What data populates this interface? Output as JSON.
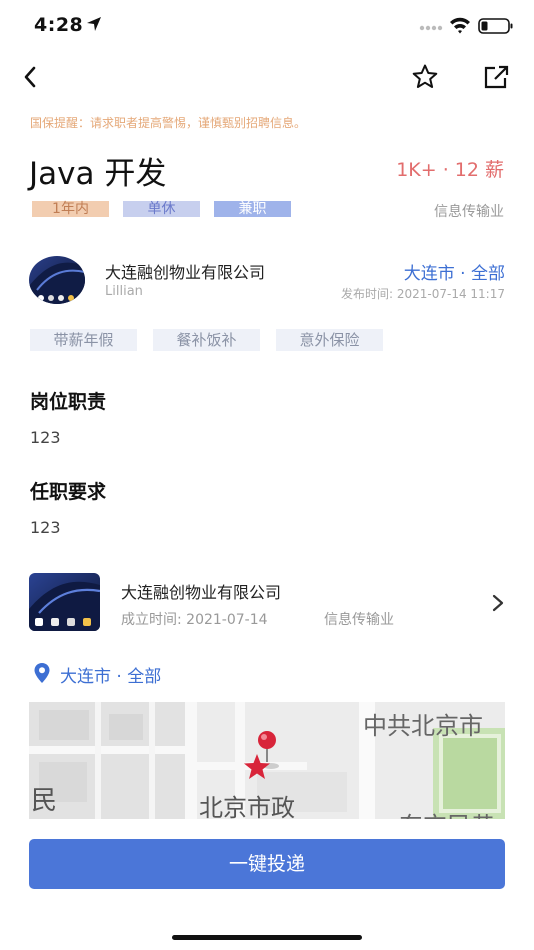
{
  "status_bar": {
    "time": "4:28"
  },
  "notice": "国保提醒：请求职者提高警惕，谨慎甄别招聘信息。",
  "job": {
    "title": "Java 开发",
    "salary": "1K+ · 12 薪",
    "tags": [
      "1年内",
      "单休",
      "兼职"
    ],
    "industry": "信息传输业"
  },
  "company_header": {
    "name": "大连融创物业有限公司",
    "recruiter": "Lillian",
    "location": "大连市 · 全部",
    "publish_time": "发布时间: 2021-07-14 11:17"
  },
  "benefits": [
    "带薪年假",
    "餐补饭补",
    "意外保险"
  ],
  "duties": {
    "title": "岗位职责",
    "text": "123"
  },
  "requirements": {
    "title": "任职要求",
    "text": "123"
  },
  "company_card": {
    "name": "大连融创物业有限公司",
    "founded": "成立时间: 2021-07-14",
    "industry": "信息传输业"
  },
  "location": {
    "text": "大连市 · 全部"
  },
  "map": {
    "labels": [
      "中共北京市",
      "北京市政",
      "民",
      "东交民巷"
    ]
  },
  "apply_button": "一键投递",
  "colors": {
    "accent": "#4b76d8",
    "salary": "#e26d6d",
    "link": "#3d6fd3",
    "notice": "#e5a878"
  }
}
